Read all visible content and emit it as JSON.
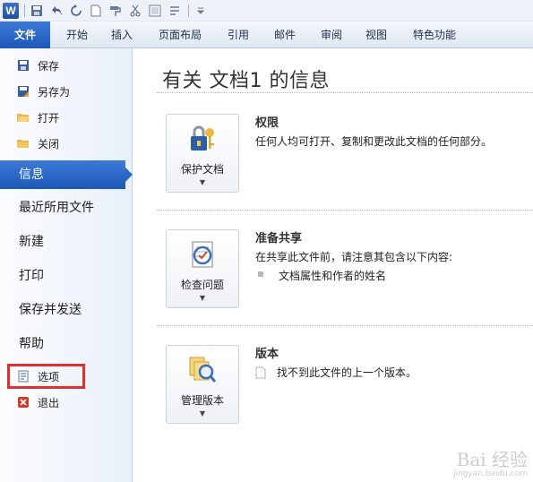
{
  "qat": {
    "logo_text": "W",
    "icons": [
      "save-icon",
      "undo-icon",
      "redo-icon",
      "new-doc-icon",
      "format-painter-icon",
      "cut-icon",
      "print-preview-icon",
      "bullets-icon",
      "customize-icon"
    ]
  },
  "tabs": {
    "file": "文件",
    "start": "开始",
    "insert": "插入",
    "layout": "页面布局",
    "refs": "引用",
    "mail": "邮件",
    "review": "审阅",
    "view": "视图",
    "special": "特色功能"
  },
  "nav": {
    "save": "保存",
    "save_as": "另存为",
    "open": "打开",
    "close": "关闭",
    "info": "信息",
    "recent": "最近所用文件",
    "new": "新建",
    "print": "打印",
    "save_send": "保存并发送",
    "help": "帮助",
    "options": "选项",
    "exit": "退出"
  },
  "main": {
    "title": "有关 文档1 的信息",
    "permissions": {
      "button_label": "保护文档",
      "heading": "权限",
      "text": "任何人均可打开、复制和更改此文档的任何部分。"
    },
    "prepare": {
      "button_label": "检查问题",
      "heading": "准备共享",
      "text": "在共享此文件前，请注意其包含以下内容:",
      "bullet": "文档属性和作者的姓名"
    },
    "versions": {
      "button_label": "管理版本",
      "heading": "版本",
      "text": "找不到此文件的上一个版本。"
    }
  },
  "watermark": {
    "brand": "Bai 经验",
    "url": "jingyan.baidu.com"
  },
  "colors": {
    "accent": "#2a66c5",
    "highlight": "#e03030"
  }
}
